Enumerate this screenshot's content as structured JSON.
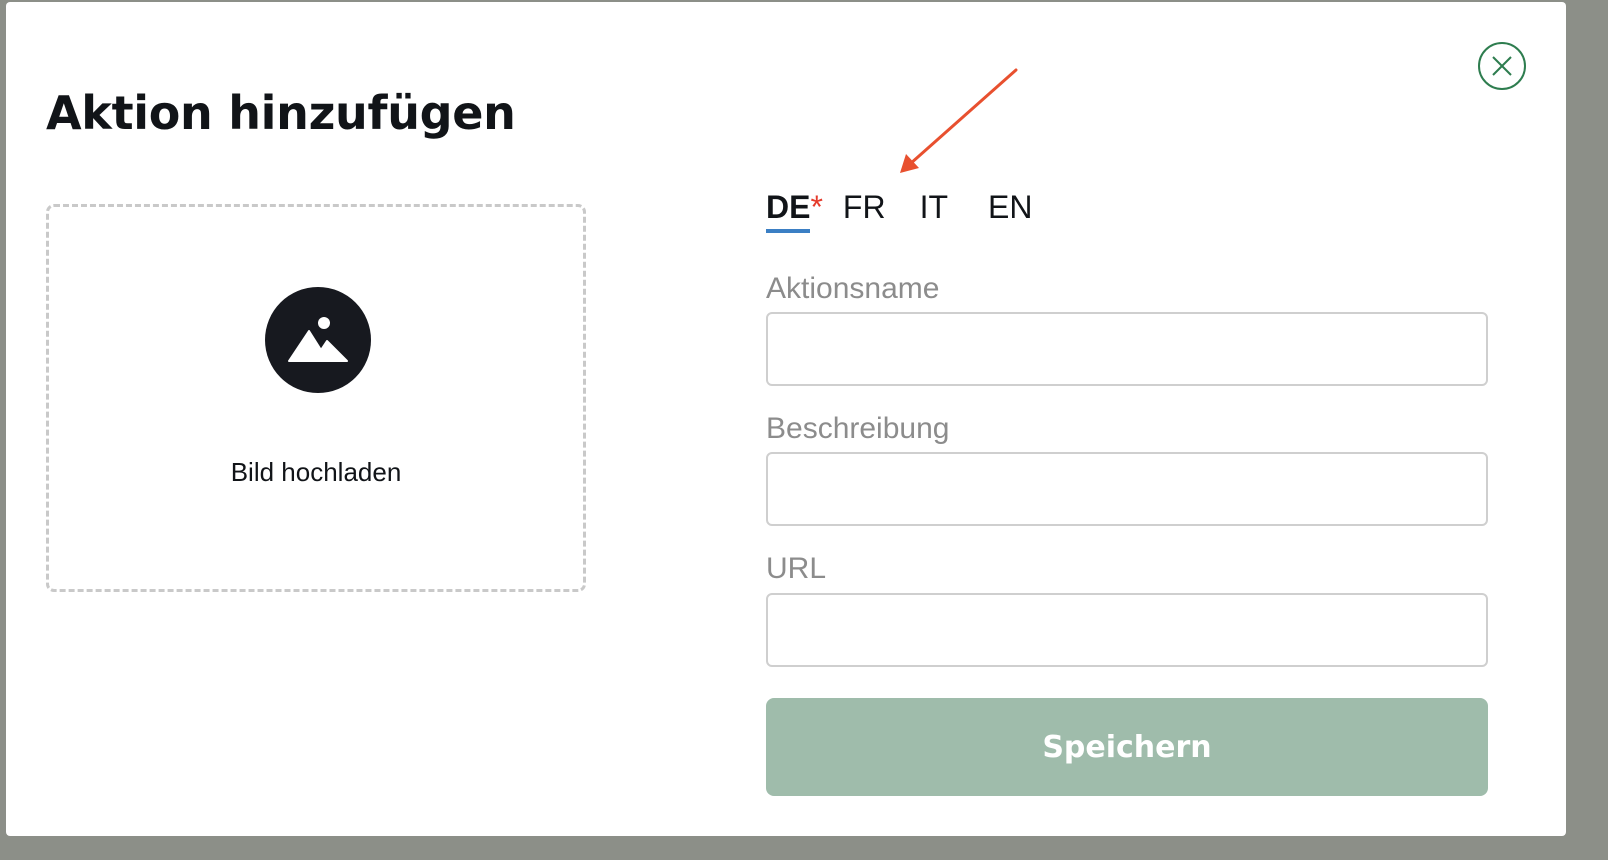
{
  "dialog": {
    "title": "Aktion hinzufügen",
    "close_icon": "close-icon"
  },
  "upload": {
    "label": "Bild hochladen",
    "icon": "image-icon"
  },
  "language_tabs": [
    {
      "label": "DE",
      "required_marker": "*",
      "active": true
    },
    {
      "label": "FR",
      "active": false
    },
    {
      "label": "IT",
      "active": false
    },
    {
      "label": "EN",
      "active": false
    }
  ],
  "form": {
    "name_label": "Aktionsname",
    "name_value": "",
    "description_label": "Beschreibung",
    "description_value": "",
    "url_label": "URL",
    "url_value": "",
    "save_label": "Speichern"
  },
  "colors": {
    "accent_green": "#2e7d4f",
    "save_button_bg": "#9fbcab",
    "active_tab_underline": "#3b7fc4",
    "required_star": "#e53b2c",
    "annotation_arrow": "#e8502f"
  }
}
